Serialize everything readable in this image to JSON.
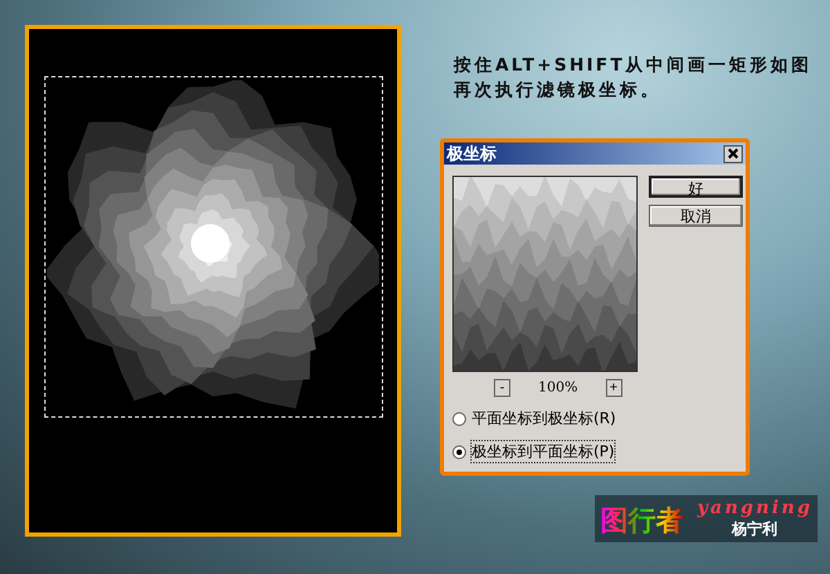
{
  "instructions": [
    "按住ALT+SHIFT从中间画一矩形如图",
    "再次执行滤镜极坐标。"
  ],
  "dialog": {
    "title": "极坐标",
    "buttons": [
      {
        "label": "好",
        "default": true
      },
      {
        "label": "取消",
        "default": false
      }
    ],
    "zoom": {
      "minus": "-",
      "value": "100%",
      "plus": "+"
    },
    "options": [
      {
        "label": "平面坐标到极坐标(R)",
        "selected": false
      },
      {
        "label": "极坐标到平面坐标(P)",
        "selected": true
      }
    ]
  },
  "signature": {
    "logo": "图行者",
    "latin": "yangning",
    "name": "杨宁利"
  }
}
